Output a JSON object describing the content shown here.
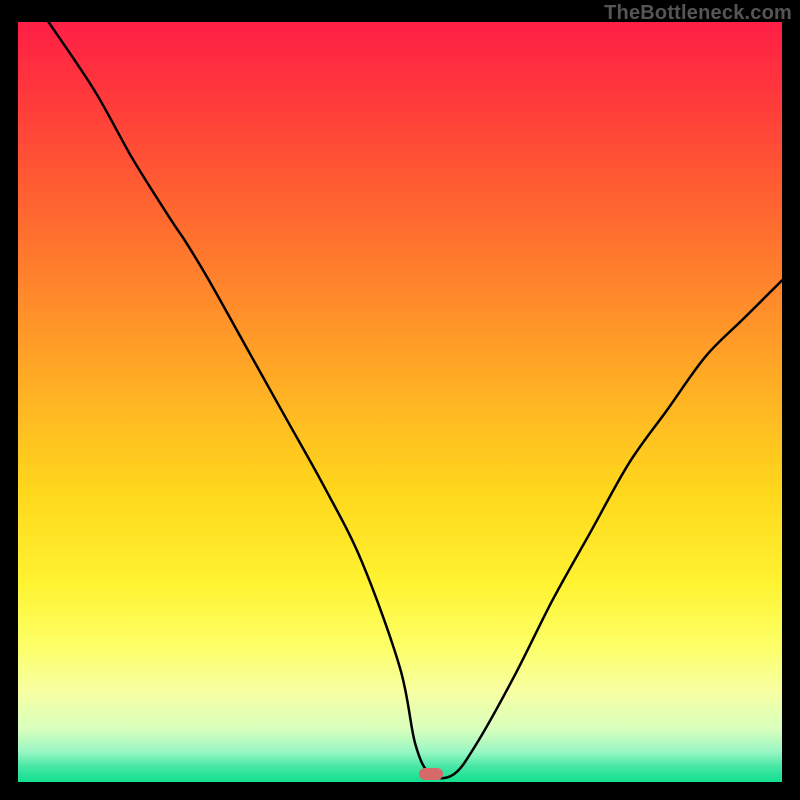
{
  "watermark": "TheBottleneck.com",
  "colors": {
    "frame": "#000000",
    "curve": "#000000",
    "marker": "#d66a6a",
    "gradient_stops": [
      {
        "pos": 0,
        "hex": "#ff1f47"
      },
      {
        "pos": 6,
        "hex": "#ff2f3f"
      },
      {
        "pos": 14,
        "hex": "#ff4538"
      },
      {
        "pos": 26,
        "hex": "#ff6a2f"
      },
      {
        "pos": 38,
        "hex": "#ff8f2a"
      },
      {
        "pos": 50,
        "hex": "#ffb523"
      },
      {
        "pos": 62,
        "hex": "#ffd81c"
      },
      {
        "pos": 74,
        "hex": "#fff332"
      },
      {
        "pos": 82,
        "hex": "#fdff66"
      },
      {
        "pos": 88,
        "hex": "#f7ffa2"
      },
      {
        "pos": 93,
        "hex": "#d9ffbc"
      },
      {
        "pos": 96,
        "hex": "#99f7c4"
      },
      {
        "pos": 98,
        "hex": "#46e7a5"
      },
      {
        "pos": 100,
        "hex": "#12df8f"
      }
    ]
  },
  "chart_data": {
    "type": "line",
    "title": "",
    "xlabel": "",
    "ylabel": "",
    "xlim": [
      0,
      100
    ],
    "ylim": [
      0,
      100
    ],
    "marker": {
      "x": 54,
      "y": 1
    },
    "series": [
      {
        "name": "bottleneck-curve",
        "x": [
          4,
          10,
          15,
          20,
          22,
          25,
          30,
          35,
          40,
          45,
          50,
          52,
          54,
          57,
          60,
          65,
          70,
          75,
          80,
          85,
          90,
          95,
          100
        ],
        "values": [
          100,
          91,
          82,
          74,
          71,
          66,
          57,
          48,
          39,
          29,
          15,
          5,
          1,
          1,
          5,
          14,
          24,
          33,
          42,
          49,
          56,
          61,
          66
        ]
      }
    ]
  }
}
